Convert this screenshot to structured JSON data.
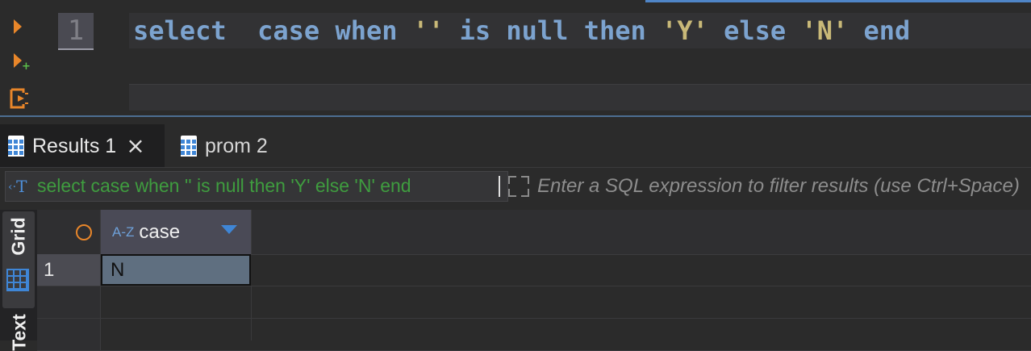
{
  "editor": {
    "line_number": "1",
    "sql_tokens": [
      {
        "text": "select",
        "kind": "kw"
      },
      {
        "text": "  ",
        "kind": "sp"
      },
      {
        "text": "case",
        "kind": "kw"
      },
      {
        "text": " ",
        "kind": "sp"
      },
      {
        "text": "when",
        "kind": "kw"
      },
      {
        "text": " ",
        "kind": "sp"
      },
      {
        "text": "''",
        "kind": "str"
      },
      {
        "text": " ",
        "kind": "sp"
      },
      {
        "text": "is",
        "kind": "kw"
      },
      {
        "text": " ",
        "kind": "sp"
      },
      {
        "text": "null",
        "kind": "kw"
      },
      {
        "text": " ",
        "kind": "sp"
      },
      {
        "text": "then",
        "kind": "kw"
      },
      {
        "text": " ",
        "kind": "sp"
      },
      {
        "text": "'Y'",
        "kind": "str"
      },
      {
        "text": " ",
        "kind": "sp"
      },
      {
        "text": "else",
        "kind": "kw"
      },
      {
        "text": " ",
        "kind": "sp"
      },
      {
        "text": "'N'",
        "kind": "str"
      },
      {
        "text": " ",
        "kind": "sp"
      },
      {
        "text": "end",
        "kind": "kw"
      }
    ],
    "icons": [
      "execute-statement-icon",
      "execute-script-icon",
      "explain-plan-icon"
    ]
  },
  "result_tabs": [
    {
      "label": "Results 1",
      "active": true,
      "closable": true
    },
    {
      "label": "prom 2",
      "active": false,
      "closable": false
    }
  ],
  "filter": {
    "query": "select case when '' is null then 'Y' else 'N' end",
    "placeholder": "Enter a SQL expression to filter results (use Ctrl+Space)"
  },
  "side_tabs": {
    "grid_label": "Grid",
    "text_label": "Text"
  },
  "grid": {
    "columns": [
      {
        "name": "case",
        "type_icon": "A-Z"
      }
    ],
    "rows": [
      {
        "num": "1",
        "cells": [
          "N"
        ]
      }
    ]
  },
  "colors": {
    "accent_orange": "#e8862a",
    "keyword_blue": "#7ca3cf",
    "string_yellow": "#c9b978",
    "filter_green": "#3f9d3f",
    "grid_blue": "#3f86d6"
  }
}
